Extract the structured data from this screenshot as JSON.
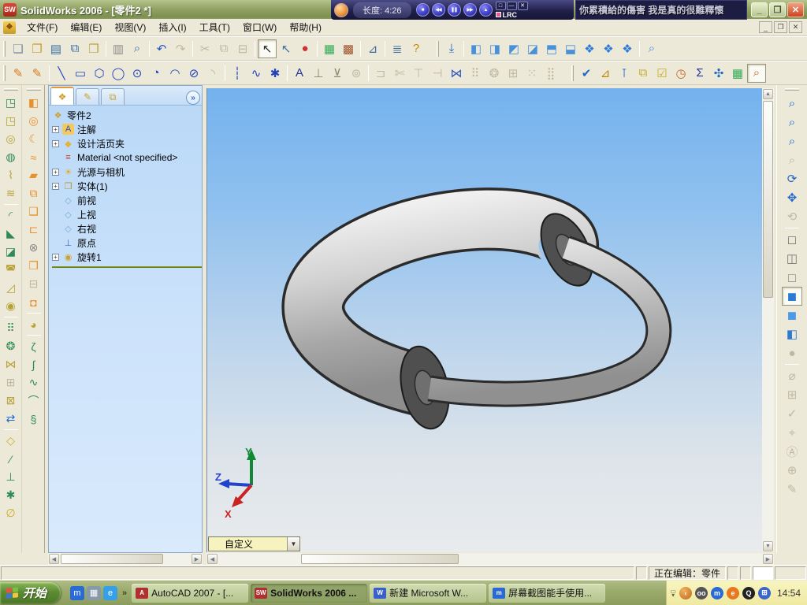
{
  "window": {
    "title": "SolidWorks 2006 - [零件2 *]",
    "controls": [
      {
        "n": "minimize-button",
        "g": "_"
      },
      {
        "n": "restore-button",
        "g": "❐"
      },
      {
        "n": "close-button",
        "g": "✕",
        "cls": "close"
      }
    ],
    "mdi_controls": [
      {
        "n": "mdi-minimize-button",
        "g": "_"
      },
      {
        "n": "mdi-restore-button",
        "g": "❐"
      },
      {
        "n": "mdi-close-button",
        "g": "✕"
      }
    ]
  },
  "player": {
    "length_label": "长度: 4:26",
    "lrc_label": "LRC",
    "lyrics": "你累積給的傷害 我是真的很難釋懷",
    "buttons": [
      {
        "n": "player-stop-button",
        "g": "■"
      },
      {
        "n": "player-prev-button",
        "g": "◀◀"
      },
      {
        "n": "player-pause-button",
        "g": "❚❚"
      },
      {
        "n": "player-next-button",
        "g": "▶▶"
      },
      {
        "n": "player-eject-button",
        "g": "▲"
      }
    ],
    "mini_buttons": [
      {
        "n": "player-restore-button",
        "g": "□"
      },
      {
        "n": "player-minimize-button",
        "g": "—"
      },
      {
        "n": "player-close-button",
        "g": "✕"
      }
    ]
  },
  "menus": [
    {
      "n": "menu-file",
      "label": "文件(F)"
    },
    {
      "n": "menu-edit",
      "label": "编辑(E)"
    },
    {
      "n": "menu-view",
      "label": "视图(V)"
    },
    {
      "n": "menu-insert",
      "label": "插入(I)"
    },
    {
      "n": "menu-tools",
      "label": "工具(T)"
    },
    {
      "n": "menu-window",
      "label": "窗口(W)"
    },
    {
      "n": "menu-help",
      "label": "帮助(H)"
    }
  ],
  "toolbar_standard": [
    {
      "n": "new-button",
      "g": "❏",
      "c": "#7a86a8"
    },
    {
      "n": "open-button",
      "g": "❐",
      "c": "#cc9a22"
    },
    {
      "n": "save-button",
      "g": "▤",
      "c": "#3a6ea5"
    },
    {
      "n": "make-drawing-button",
      "g": "⧉",
      "c": "#3a6ea5"
    },
    {
      "n": "make-assembly-button",
      "g": "❒",
      "c": "#b8a23a"
    },
    {
      "s": true
    },
    {
      "n": "print-button",
      "g": "▥",
      "c": "#8a8a8a"
    },
    {
      "n": "print-preview-button",
      "g": "⌕",
      "c": "#3a6ea5"
    },
    {
      "s": true
    },
    {
      "n": "undo-button",
      "g": "↶",
      "c": "#2255cc"
    },
    {
      "n": "redo-button",
      "g": "↷",
      "d": true
    },
    {
      "s": true
    },
    {
      "n": "cut-button",
      "g": "✂",
      "d": true
    },
    {
      "n": "copy-button",
      "g": "⧉",
      "d": true
    },
    {
      "n": "paste-button",
      "g": "⊟",
      "d": true
    },
    {
      "s": true
    },
    {
      "n": "select-button",
      "g": "↖",
      "c": "#222",
      "p": true
    },
    {
      "n": "select-filter-button",
      "g": "↖",
      "c": "#3a6ea5"
    },
    {
      "n": "performance-light-button",
      "g": "●",
      "c": "#cc3333"
    },
    {
      "s": true
    },
    {
      "n": "edit-color-button",
      "g": "▦",
      "c": "#33aa55"
    },
    {
      "n": "texture-button",
      "g": "▩",
      "c": "#a0522d"
    },
    {
      "s": true
    },
    {
      "n": "measure-dropdown-button",
      "g": "⊿",
      "c": "#3a6ea5"
    },
    {
      "s": true
    },
    {
      "n": "options-button",
      "g": "≣",
      "c": "#3a6ea5"
    },
    {
      "n": "help-button",
      "g": "?",
      "c": "#cc8800"
    }
  ],
  "toolbar_views": [
    {
      "n": "normal-to-button",
      "g": "⤓",
      "c": "#2266cc"
    },
    {
      "s": true
    },
    {
      "n": "view-front-button",
      "g": "◧",
      "c": "#4a90d9"
    },
    {
      "n": "view-back-button",
      "g": "◨",
      "c": "#4a90d9"
    },
    {
      "n": "view-left-button",
      "g": "◩",
      "c": "#4a90d9"
    },
    {
      "n": "view-right-button",
      "g": "◪",
      "c": "#4a90d9"
    },
    {
      "n": "view-top-button",
      "g": "⬒",
      "c": "#4a90d9"
    },
    {
      "n": "view-bottom-button",
      "g": "⬓",
      "c": "#4a90d9"
    },
    {
      "n": "view-isometric-button",
      "g": "❖",
      "c": "#2b7bd4"
    },
    {
      "n": "view-trimetric-button",
      "g": "❖",
      "c": "#2b7bd4"
    },
    {
      "n": "view-dimetric-button",
      "g": "❖",
      "c": "#2b7bd4"
    },
    {
      "s": true
    },
    {
      "n": "magnifier-button",
      "g": "⌕",
      "c": "#4a90d9"
    }
  ],
  "toolbar_sketch": [
    {
      "n": "sketch-button",
      "g": "✎",
      "c": "#d87a22"
    },
    {
      "n": "sketch-3d-button",
      "g": "✎",
      "c": "#d87a22"
    },
    {
      "s": true
    },
    {
      "n": "line-button",
      "g": "╲",
      "c": "#2244bb"
    },
    {
      "n": "rectangle-button",
      "g": "▭",
      "c": "#2244bb"
    },
    {
      "n": "polygon-button",
      "g": "⬡",
      "c": "#2244bb"
    },
    {
      "n": "circle-button",
      "g": "◯",
      "c": "#2244bb"
    },
    {
      "n": "perimeter-circle-button",
      "g": "⊙",
      "c": "#2244bb"
    },
    {
      "n": "centerpoint-arc-button",
      "g": "◔",
      "c": "#2244bb"
    },
    {
      "n": "tangent-arc-button",
      "g": "◠",
      "c": "#2244bb"
    },
    {
      "n": "ellipse-button",
      "g": "⊘",
      "c": "#2244bb"
    },
    {
      "n": "sketch-fillet-button",
      "g": "◝",
      "d": true
    },
    {
      "s": true
    },
    {
      "n": "centerline-button",
      "g": "┆",
      "c": "#2244bb"
    },
    {
      "n": "spline-button",
      "g": "∿",
      "c": "#2244bb"
    },
    {
      "n": "point-button",
      "g": "✱",
      "c": "#2244bb"
    },
    {
      "s": true
    },
    {
      "n": "sketch-text-button",
      "g": "A",
      "c": "#223399"
    },
    {
      "n": "add-relation-button",
      "g": "⊥",
      "c": "#8a8a6a"
    },
    {
      "n": "display-relations-button",
      "g": "⊻",
      "c": "#8a8a6a"
    },
    {
      "n": "modify-sketch-button",
      "g": "⊚",
      "d": true
    },
    {
      "s": true
    },
    {
      "n": "convert-entities-button",
      "g": "⊐",
      "d": true
    },
    {
      "n": "trim-entities-button",
      "g": "✄",
      "d": true
    },
    {
      "n": "extend-entities-button",
      "g": "⊤",
      "d": true
    },
    {
      "n": "offset-entities-button",
      "g": "⊣",
      "d": true
    },
    {
      "n": "mirror-entities-button",
      "g": "⋈",
      "c": "#3355bb"
    },
    {
      "n": "linear-sketch-pattern-button",
      "g": "⠿",
      "d": true
    },
    {
      "n": "circular-sketch-pattern-button",
      "g": "❂",
      "d": true
    },
    {
      "n": "sketch-picture-button",
      "g": "⊞",
      "d": true
    },
    {
      "n": "construction-geometry-button",
      "g": "⁙",
      "d": true
    },
    {
      "n": "grid-snap-button",
      "g": "⣿",
      "d": true
    }
  ],
  "toolbar_tools": [
    {
      "n": "spellcheck-button",
      "g": "✔",
      "c": "#2266cc"
    },
    {
      "n": "measure-button",
      "g": "⊿",
      "c": "#b8860b"
    },
    {
      "n": "mass-properties-button",
      "g": "⊺",
      "c": "#2266cc"
    },
    {
      "n": "section-properties-button",
      "g": "⧉",
      "c": "#ccaa22"
    },
    {
      "n": "check-entity-button",
      "g": "☑",
      "c": "#ccaa22"
    },
    {
      "n": "performance-eval-button",
      "g": "◷",
      "c": "#cc6622"
    },
    {
      "n": "equations-button",
      "g": "Σ",
      "c": "#223399"
    },
    {
      "n": "import-diagnostics-button",
      "g": "✣",
      "c": "#2266cc"
    },
    {
      "n": "design-table-button",
      "g": "▦",
      "c": "#33aa55"
    },
    {
      "n": "search-button",
      "g": "⌕",
      "c": "#cc6622",
      "p": true
    }
  ],
  "left_toolbar_features": [
    {
      "n": "extruded-boss-button",
      "g": "◳",
      "c": "#2e8b57"
    },
    {
      "n": "extruded-cut-button",
      "g": "◳",
      "c": "#b8a23a"
    },
    {
      "n": "revolved-boss-button",
      "g": "◎",
      "c": "#b8a23a"
    },
    {
      "n": "revolved-cut-button",
      "g": "◍",
      "c": "#2e8b57"
    },
    {
      "n": "swept-boss-button",
      "g": "⌇",
      "c": "#b8a23a"
    },
    {
      "n": "lofted-boss-button",
      "g": "≋",
      "c": "#b8a23a"
    },
    {
      "s": true
    },
    {
      "n": "fillet-feature-button",
      "g": "◜",
      "c": "#2e8b57"
    },
    {
      "n": "chamfer-button",
      "g": "◣",
      "c": "#2e8b57"
    },
    {
      "n": "rib-button",
      "g": "◪",
      "c": "#2e8b57"
    },
    {
      "n": "shell-button",
      "g": "◚",
      "c": "#b8a23a"
    },
    {
      "n": "draft-button",
      "g": "◿",
      "c": "#b8a23a"
    },
    {
      "n": "hole-wizard-button",
      "g": "◉",
      "c": "#b8a23a"
    },
    {
      "s": true
    },
    {
      "n": "linear-pattern-button",
      "g": "⠿",
      "c": "#2e8b57"
    },
    {
      "n": "circular-pattern-button",
      "g": "❂",
      "c": "#2e8b57"
    },
    {
      "n": "mirror-feature-button",
      "g": "⋈",
      "c": "#b8a23a"
    },
    {
      "n": "combine-button",
      "g": "⊞",
      "d": true
    },
    {
      "n": "delete-body-button",
      "g": "⊠",
      "c": "#b8a23a"
    },
    {
      "n": "move-copy-body-button",
      "g": "⇄",
      "c": "#2266cc"
    },
    {
      "s": true
    },
    {
      "n": "reference-plane-button",
      "g": "◇",
      "c": "#ccaa22"
    },
    {
      "n": "reference-axis-button",
      "g": "⁄",
      "c": "#2e8b57"
    },
    {
      "n": "coordinate-system-button",
      "g": "⊥",
      "c": "#2e8b57"
    },
    {
      "n": "reference-point-button",
      "g": "✱",
      "c": "#2e8b57"
    },
    {
      "n": "mate-reference-button",
      "g": "∅",
      "c": "#ccaa22"
    }
  ],
  "left_toolbar_surfaces": [
    {
      "n": "extruded-surface-button",
      "g": "◧",
      "c": "#e8912d"
    },
    {
      "n": "revolved-surface-button",
      "g": "◎",
      "c": "#e8912d"
    },
    {
      "n": "swept-surface-button",
      "g": "☾",
      "c": "#e8912d"
    },
    {
      "n": "lofted-surface-button",
      "g": "≈",
      "c": "#e8912d"
    },
    {
      "n": "planar-surface-button",
      "g": "▰",
      "c": "#e8912d"
    },
    {
      "n": "offset-surface-button",
      "g": "⧉",
      "c": "#e8912d"
    },
    {
      "n": "knit-surface-button",
      "g": "❑",
      "c": "#e8912d"
    },
    {
      "n": "extend-surface-button",
      "g": "⊏",
      "c": "#e8912d"
    },
    {
      "n": "delete-face-button",
      "g": "⊗",
      "c": "#888888"
    },
    {
      "n": "replace-face-button",
      "g": "❒",
      "c": "#e8912d"
    },
    {
      "n": "mid-surface-button",
      "g": "⊟",
      "d": true
    },
    {
      "n": "thicken-button",
      "g": "◘",
      "c": "#e8912d"
    },
    {
      "s": true
    },
    {
      "n": "fillet-surface-button",
      "g": "◕",
      "c": "#b8a23a"
    },
    {
      "s": true
    },
    {
      "n": "split-line-button",
      "g": "ζ",
      "c": "#2e8b57"
    },
    {
      "n": "project-curve-button",
      "g": "∫",
      "c": "#2e8b57"
    },
    {
      "n": "composite-curve-button",
      "g": "∿",
      "c": "#2e8b57"
    },
    {
      "n": "curve-through-points-button",
      "g": "⌒",
      "c": "#2e8b57"
    },
    {
      "n": "helix-spiral-button",
      "g": "§",
      "c": "#2e8b57"
    }
  ],
  "right_toolbar": [
    {
      "n": "zoom-to-fit-button",
      "g": "⌕",
      "c": "#2266cc"
    },
    {
      "n": "zoom-to-area-button",
      "g": "⌕",
      "c": "#2266cc"
    },
    {
      "n": "zoom-in-out-button",
      "g": "⌕",
      "c": "#2266cc"
    },
    {
      "n": "zoom-to-selection-button",
      "g": "⌕",
      "d": true
    },
    {
      "n": "rotate-view-button",
      "g": "⟳",
      "c": "#2266cc"
    },
    {
      "n": "pan-button",
      "g": "✥",
      "c": "#2266cc"
    },
    {
      "n": "rotate-about-scene-button",
      "g": "⟲",
      "d": true
    },
    {
      "s": true
    },
    {
      "n": "wireframe-button",
      "g": "◻",
      "c": "#777777"
    },
    {
      "n": "hidden-lines-visible-button",
      "g": "◫",
      "c": "#777777"
    },
    {
      "n": "hidden-lines-removed-button",
      "g": "◻",
      "c": "#999999"
    },
    {
      "n": "shaded-with-edges-button",
      "g": "◼",
      "c": "#2b7bd4",
      "p": true
    },
    {
      "n": "shaded-button",
      "g": "◼",
      "c": "#4a9ae8"
    },
    {
      "n": "section-view-button",
      "g": "◧",
      "c": "#2b7bd4"
    },
    {
      "n": "shadows-button",
      "g": "●",
      "d": true
    },
    {
      "s": true
    },
    {
      "n": "smart-dimension-button",
      "g": "⌀",
      "d": true
    },
    {
      "n": "note-button",
      "g": "⊞",
      "d": true
    },
    {
      "n": "surface-finish-button",
      "g": "✓",
      "d": true
    },
    {
      "n": "geometric-tolerance-button",
      "g": "⌖",
      "d": true
    },
    {
      "n": "datum-feature-button",
      "g": "Ⓐ",
      "d": true
    },
    {
      "n": "balloon-button",
      "g": "⊕",
      "d": true
    },
    {
      "n": "weld-symbol-button",
      "g": "✎",
      "d": true
    }
  ],
  "tree": {
    "tabs": [
      {
        "n": "tab-featuremanager",
        "g": "❖",
        "c": "#caa22a",
        "p": true
      },
      {
        "n": "tab-propertymanager",
        "g": "✎",
        "c": "#caa22a"
      },
      {
        "n": "tab-configurationmanager",
        "g": "⧉",
        "c": "#caa22a"
      }
    ],
    "chevron": "»",
    "root": {
      "label": "零件2",
      "g": "❖",
      "c": "#caa22a"
    },
    "items": [
      {
        "n": "tree-item-annotations",
        "e": true,
        "g": "A",
        "c": "#2850c8",
        "bg": "#f5c95c",
        "label": "注解"
      },
      {
        "n": "tree-item-design-binder",
        "e": true,
        "g": "◆",
        "c": "#e0b53a",
        "label": "设计活页夹"
      },
      {
        "n": "tree-item-material",
        "g": "≡",
        "c": "#c84028",
        "label": "Material <not specified>"
      },
      {
        "n": "tree-item-lights-cameras",
        "e": true,
        "g": "☀",
        "c": "#e8a81e",
        "label": "光源与相机"
      },
      {
        "n": "tree-item-solid-bodies",
        "e": true,
        "g": "❒",
        "c": "#b8922a",
        "label": "实体(1)"
      },
      {
        "n": "tree-item-front-plane",
        "g": "◇",
        "c": "#7aa8d8",
        "label": "前视"
      },
      {
        "n": "tree-item-top-plane",
        "g": "◇",
        "c": "#7aa8d8",
        "label": "上视"
      },
      {
        "n": "tree-item-right-plane",
        "g": "◇",
        "c": "#7aa8d8",
        "label": "右视"
      },
      {
        "n": "tree-item-origin",
        "g": "⊥",
        "c": "#3a66cc",
        "label": "原点"
      },
      {
        "n": "tree-item-revolve1",
        "e": true,
        "g": "◉",
        "c": "#caa22a",
        "label": "旋转1"
      }
    ]
  },
  "viewport": {
    "view_combo_value": "自定义",
    "triad": {
      "x_label": "X",
      "y_label": "Y",
      "z_label": "Z",
      "x_color": "#cc2222",
      "y_color": "#118833",
      "z_color": "#2244cc"
    }
  },
  "statusbar": {
    "editing": "正在编辑：零件"
  },
  "taskbar": {
    "start_label": "开始",
    "quick_launch": [
      {
        "n": "quicklaunch-maxthon",
        "g": "m",
        "bg": "#2a6ad4"
      },
      {
        "n": "quicklaunch-media",
        "g": "▦",
        "bg": "#8899aa"
      },
      {
        "n": "quicklaunch-ie",
        "g": "e",
        "bg": "#35a0e8"
      }
    ],
    "quick_launch_more": "»",
    "tasks": [
      {
        "n": "task-autocad",
        "label": "AutoCAD 2007 - [...",
        "g": "A",
        "gc": "#fff",
        "gbg": "#b03030"
      },
      {
        "n": "task-solidworks",
        "label": "SolidWorks 2006 ...",
        "g": "SW",
        "gc": "#fff",
        "gbg": "#b03030",
        "active": true
      },
      {
        "n": "task-word",
        "label": "新建 Microsoft W...",
        "g": "W",
        "gc": "#fff",
        "gbg": "#3a5fc8"
      },
      {
        "n": "task-screenshot",
        "label": "屏幕截图能手使用...",
        "g": "m",
        "gc": "#fff",
        "gbg": "#2a6ad4"
      }
    ],
    "tray_icons": [
      {
        "n": "tray-eyes",
        "g": "oo",
        "bg": "#555555"
      },
      {
        "n": "tray-maxthon",
        "g": "m",
        "bg": "#2a6ad4"
      },
      {
        "n": "tray-flashget",
        "g": "e",
        "bg": "#e87820"
      },
      {
        "n": "tray-qq",
        "g": "Q",
        "bg": "#222222"
      },
      {
        "n": "tray-network",
        "g": "⊞",
        "bg": "#3a66cc"
      }
    ],
    "time": "14:54"
  }
}
